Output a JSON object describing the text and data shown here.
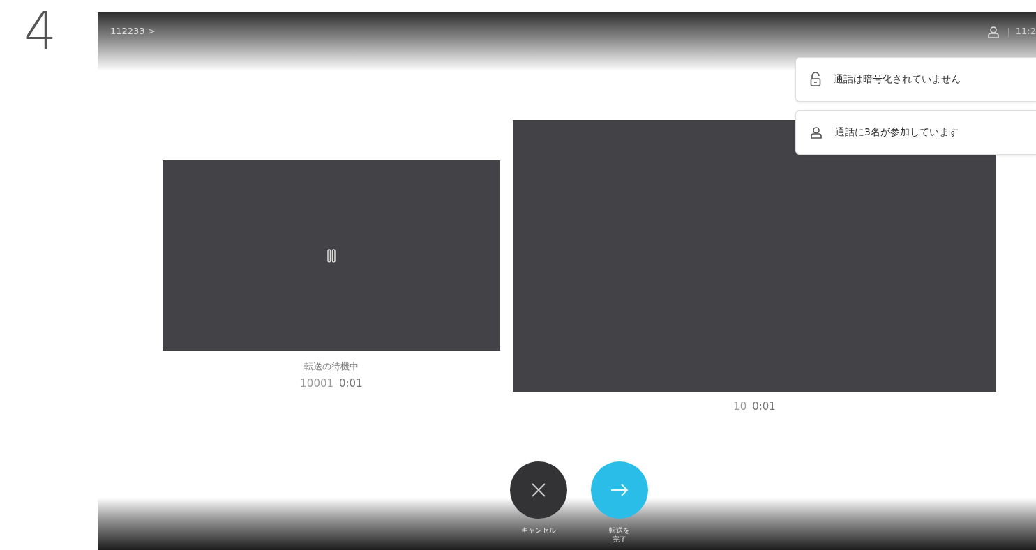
{
  "step": "4",
  "header": {
    "caller": "112233 >",
    "time": "11:2"
  },
  "notifications": [
    {
      "kind": "unlocked",
      "text": "通話は暗号化されていません"
    },
    {
      "kind": "person",
      "text": "通話に3名が参加しています"
    }
  ],
  "tiles": [
    {
      "kind": "held",
      "status": "転送の待機中",
      "number": "10001",
      "duration": "0:01"
    },
    {
      "kind": "active",
      "number": "10",
      "duration": "0:01"
    }
  ],
  "actions": [
    {
      "kind": "cancel",
      "label": "キャンセル"
    },
    {
      "kind": "complete",
      "label": "転送を完了"
    }
  ]
}
